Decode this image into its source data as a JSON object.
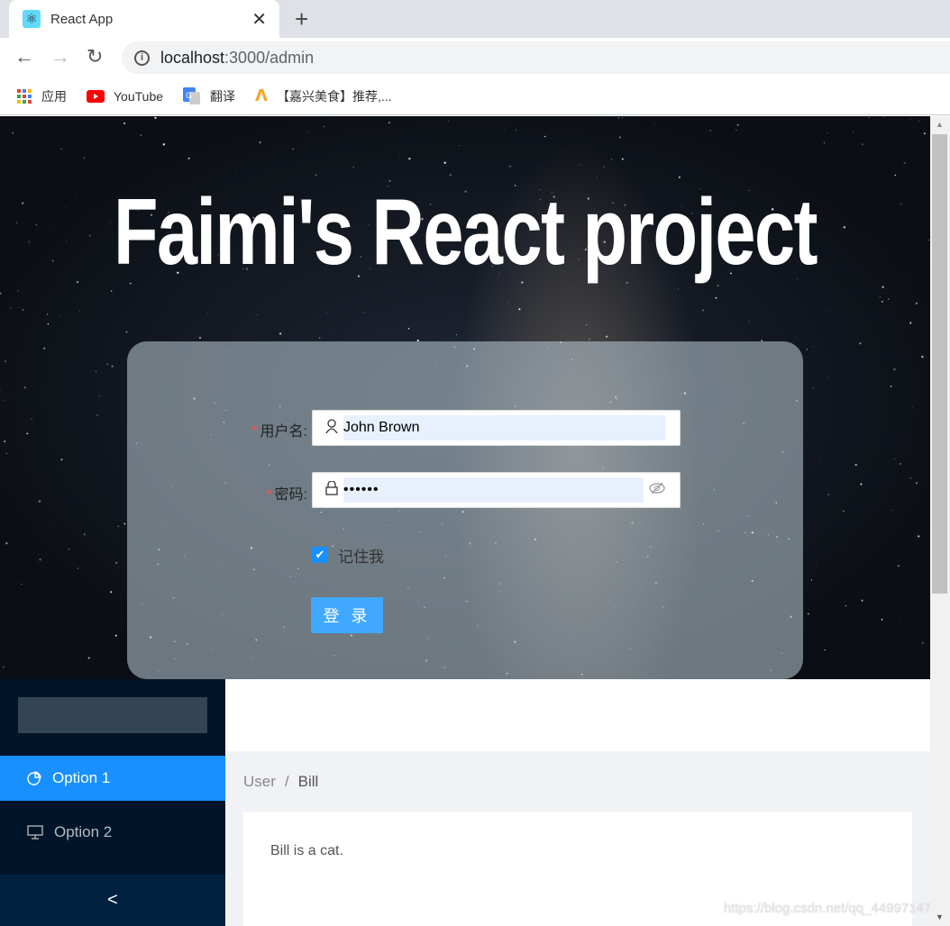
{
  "browser": {
    "tab_title": "React App",
    "url_host": "localhost",
    "url_path": ":3000/admin",
    "bookmarks": [
      {
        "label": "应用",
        "icon": "apps-grid-icon"
      },
      {
        "label": "YouTube",
        "icon": "youtube-icon"
      },
      {
        "label": "翻译",
        "icon": "google-translate-icon"
      },
      {
        "label": "【嘉兴美食】推荐,...",
        "icon": "dianping-icon"
      }
    ]
  },
  "hero": {
    "title": "Faimi's React project"
  },
  "login": {
    "username_label": "用户名:",
    "username_value": "John Brown",
    "password_label": "密码:",
    "password_value": "••••••",
    "remember_label": "记住我",
    "remember_checked": true,
    "submit_label": "登 录"
  },
  "sidebar": {
    "items": [
      {
        "label": "Option 1",
        "icon": "pie-chart-icon",
        "selected": true
      },
      {
        "label": "Option 2",
        "icon": "desktop-icon",
        "selected": false
      }
    ],
    "collapse_glyph": "<"
  },
  "breadcrumb": {
    "items": [
      "User",
      "Bill"
    ],
    "separator": "/"
  },
  "content": {
    "text": "Bill is a cat."
  },
  "watermark": "https://blog.csdn.net/qq_44997147",
  "colors": {
    "primary": "#1890ff",
    "sider": "#001529",
    "button": "#40a9ff"
  }
}
